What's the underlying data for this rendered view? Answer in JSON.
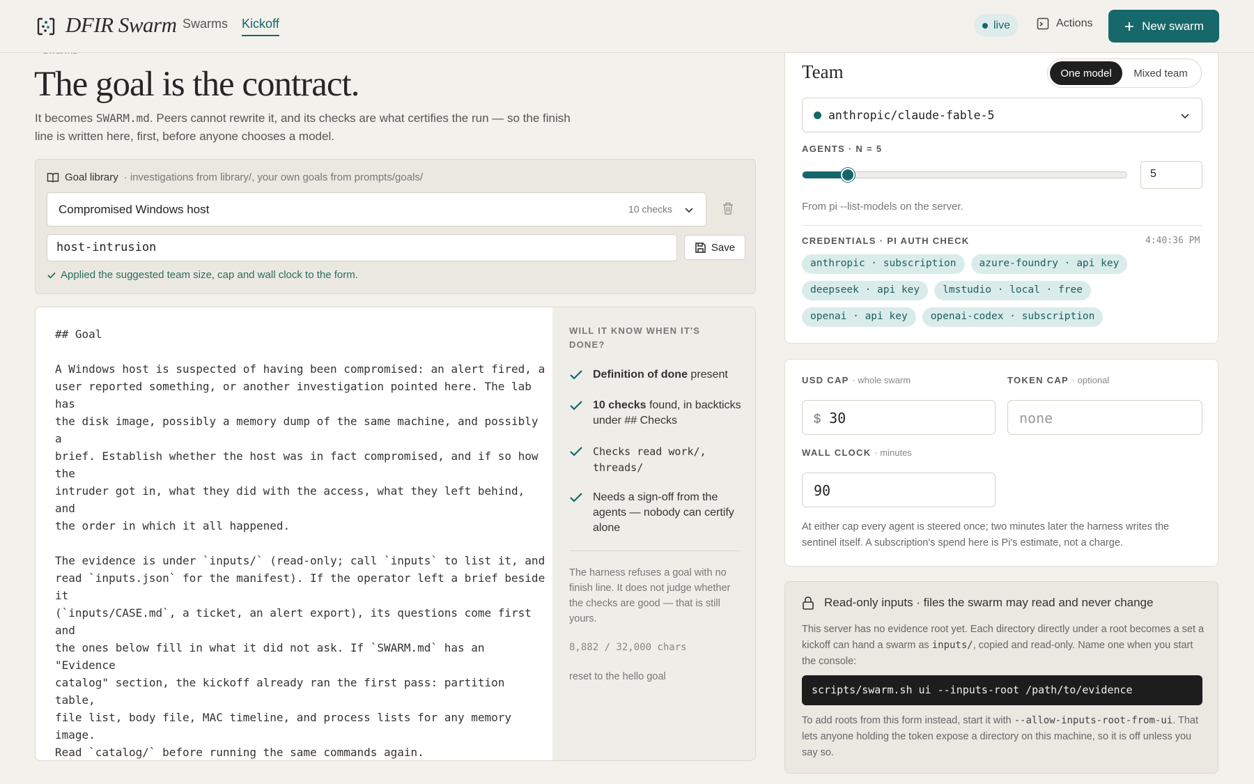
{
  "header": {
    "app_name": "DFIR Swarm",
    "nav": [
      "Swarms",
      "Kickoff"
    ],
    "live_label": "live",
    "actions_label": "Actions",
    "new_swarm_label": "New swarm"
  },
  "breadcrumb": "Swarms",
  "page": {
    "title": "The goal is the contract.",
    "intro_before": "It becomes ",
    "intro_code": "SWARM.md",
    "intro_after": ". Peers cannot rewrite it, and its checks are what certifies the run — so the finish line is written here, first, before anyone chooses a model."
  },
  "library": {
    "title": "Goal library",
    "subtitle": "· investigations from library/, your own goals from prompts/goals/",
    "selected_goal": "Compromised Windows host",
    "checks_count": "10 checks",
    "slug_value": "host-intrusion",
    "save_label": "Save",
    "applied_msg": "Applied the suggested team size, cap and wall clock to the form."
  },
  "editor": {
    "content": "## Goal\n\nA Windows host is suspected of having been compromised: an alert fired, a\nuser reported something, or another investigation pointed here. The lab\nhas\nthe disk image, possibly a memory dump of the same machine, and possibly\na\nbrief. Establish whether the host was in fact compromised, and if so how\nthe\nintruder got in, what they did with the access, what they left behind,\nand\nthe order in which it all happened.\n\nThe evidence is under `inputs/` (read-only; call `inputs` to list it, and\nread `inputs.json` for the manifest). If the operator left a brief beside\nit\n(`inputs/CASE.md`, a ticket, an alert export), its questions come first\nand\nthe ones below fill in what it did not ask. If `SWARM.md` has an\n\"Evidence\ncatalog\" section, the kickoff already ran the first pass: partition\ntable,\nfile list, body file, MAC timeline, and process lists for any memory\nimage.\nRead `catalog/` before running the same commands again."
  },
  "checks_panel": {
    "title": "WILL IT KNOW WHEN IT'S DONE?",
    "items": [
      {
        "bold": "Definition of done",
        "rest": " present"
      },
      {
        "bold": "10 checks",
        "rest": " found, in backticks under ## Checks"
      },
      {
        "bold": "",
        "rest": "Checks read work/, threads/"
      },
      {
        "bold": "",
        "rest": "Needs a sign-off from the agents — nobody can certify alone"
      }
    ],
    "note": "The harness refuses a goal with no finish line. It does not judge whether the checks are good — that is still yours.",
    "chars": "8,882 / 32,000 chars",
    "reset_label": "reset to the hello goal"
  },
  "team": {
    "title": "Team",
    "mode_options": [
      "One model",
      "Mixed team"
    ],
    "selected_mode": "One model",
    "model": "anthropic/claude-fable-5",
    "agents_label": "AGENTS · N = 5",
    "agents_value": "5",
    "agents_fraction": 0.14,
    "models_note": "From pi --list-models on the server.",
    "credentials_label": "CREDENTIALS · PI AUTH CHECK",
    "credentials_time": "4:40:36 PM",
    "credentials": [
      "anthropic · subscription",
      "azure-foundry · api key",
      "deepseek · api key",
      "lmstudio · local · free",
      "openai · api key",
      "openai-codex · subscription"
    ]
  },
  "caps": {
    "usd_label": "USD CAP",
    "usd_hint": "· whole swarm",
    "usd_symbol": "$",
    "usd_value": "30",
    "token_label": "TOKEN CAP",
    "token_hint": "· optional",
    "token_placeholder": "none",
    "wall_label": "WALL CLOCK",
    "wall_hint": "· minutes",
    "wall_value": "90",
    "note": "At either cap every agent is steered once; two minutes later the harness writes the sentinel itself. A subscription's spend here is Pi's estimate, not a charge."
  },
  "readonly": {
    "title": "Read-only inputs · files the swarm may read and never change",
    "text_before": "This server has no evidence root yet. Each directory directly under a root becomes a set a kickoff can hand a swarm as ",
    "text_code": "inputs/",
    "text_after": ", copied and read-only. Name one when you start the console:",
    "command": "scripts/swarm.sh ui --inputs-root /path/to/evidence",
    "text2_before": "To add roots from this form instead, start it with ",
    "text2_code": "--allow-inputs-root-from-ui",
    "text2_after": ". That lets anyone holding the token expose a directory on this machine, so it is off unless you say so."
  },
  "colors": {
    "accent": "#17686b",
    "background": "#f3f1ec",
    "chip_bg": "#d9ecea"
  }
}
